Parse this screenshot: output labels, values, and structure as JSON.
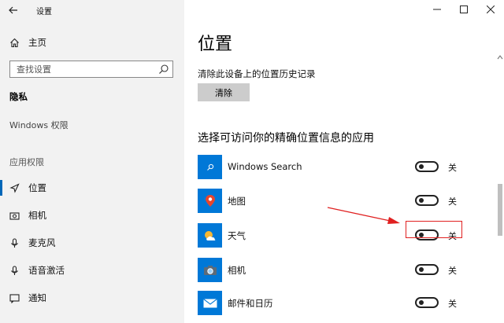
{
  "window": {
    "title": "设置"
  },
  "sidebar": {
    "home_label": "主页",
    "search_placeholder": "查找设置",
    "section_heading": "隐私",
    "windows_permissions": "Windows 权限",
    "group_label": "应用权限",
    "items": [
      {
        "label": "位置",
        "icon": "location-icon",
        "active": true
      },
      {
        "label": "相机",
        "icon": "camera-icon",
        "active": false
      },
      {
        "label": "麦克风",
        "icon": "microphone-icon",
        "active": false
      },
      {
        "label": "语音激活",
        "icon": "voice-activation-icon",
        "active": false
      },
      {
        "label": "通知",
        "icon": "notification-icon",
        "active": false
      }
    ]
  },
  "main": {
    "title": "位置",
    "history_label": "清除此设备上的位置历史记录",
    "clear_button": "清除",
    "apps_heading": "选择可访问你的精确位置信息的应用",
    "apps": [
      {
        "name": "Windows Search",
        "state": "关",
        "icon": "search-app-icon",
        "color": "#0078d7"
      },
      {
        "name": "地图",
        "state": "关",
        "icon": "maps-app-icon",
        "color": "#0078d7"
      },
      {
        "name": "天气",
        "state": "关",
        "icon": "weather-app-icon",
        "color": "#0078d7"
      },
      {
        "name": "相机",
        "state": "关",
        "icon": "camera-app-icon",
        "color": "#0078d7"
      },
      {
        "name": "邮件和日历",
        "state": "关",
        "icon": "mail-app-icon",
        "color": "#0078d7"
      }
    ]
  },
  "colors": {
    "accent": "#0067b8",
    "app_tile": "#0078d7",
    "annotation": "#e02020"
  }
}
